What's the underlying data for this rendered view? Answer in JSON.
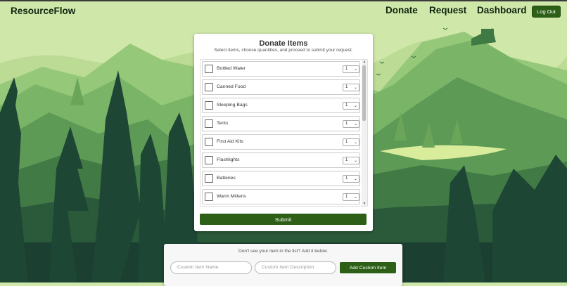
{
  "navbar": {
    "brand": "ResourceFlow",
    "links": [
      "Donate",
      "Request",
      "Dashboard"
    ],
    "logout_label": "Log Out"
  },
  "donate_card": {
    "title": "Donate Items",
    "subtitle": "Select items, choose quantities, and proceed to submit your request.",
    "items": [
      {
        "label": "Bottled Water",
        "quantity": "1",
        "checked": false
      },
      {
        "label": "Canned Food",
        "quantity": "1",
        "checked": false
      },
      {
        "label": "Sleeping Bags",
        "quantity": "1",
        "checked": false
      },
      {
        "label": "Tents",
        "quantity": "1",
        "checked": false
      },
      {
        "label": "First Aid Kits",
        "quantity": "1",
        "checked": false
      },
      {
        "label": "Flashlights",
        "quantity": "1",
        "checked": false
      },
      {
        "label": "Batteries",
        "quantity": "1",
        "checked": false
      },
      {
        "label": "Warm Mittens",
        "quantity": "1",
        "checked": false
      }
    ],
    "submit_label": "Submit"
  },
  "custom_item": {
    "prompt": "Don't see your item in the list? Add it below.",
    "name_placeholder": "Custom Item Name",
    "description_placeholder": "Custom Item Description",
    "add_label": "Add Custom Item"
  },
  "colors": {
    "accent": "#2d6016",
    "sky": "#cfe7a8"
  }
}
